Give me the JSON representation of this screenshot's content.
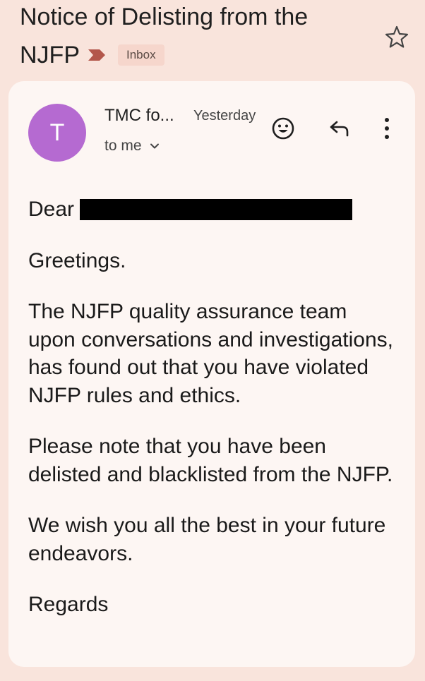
{
  "subject": {
    "line1": "Notice of Delisting from the",
    "line2": "NJFP",
    "label": "Inbox"
  },
  "message": {
    "avatar_letter": "T",
    "sender": "TMC fo...",
    "time": "Yesterday",
    "recipient": "to me"
  },
  "body": {
    "salutation": "Dear",
    "greeting": "Greetings.",
    "paragraph1": "The NJFP quality assurance team upon conversations and investigations, has found out that you have violated NJFP rules and ethics.",
    "paragraph2": "Please note that you have been delisted and blacklisted from the NJFP.",
    "paragraph3": "We wish you all the best in your future endeavors.",
    "closing": "Regards"
  },
  "icons": {
    "importance": "importance-marker-icon",
    "star": "star-icon",
    "emoji": "add-reaction-icon",
    "reply": "reply-icon",
    "more": "more-vert-icon",
    "expand": "chevron-down-icon"
  },
  "colors": {
    "background": "#f9e4dc",
    "card": "#fdf6f3",
    "avatar": "#b56ad1",
    "importance": "#b3574b",
    "label_chip": "#f6d6cc"
  }
}
